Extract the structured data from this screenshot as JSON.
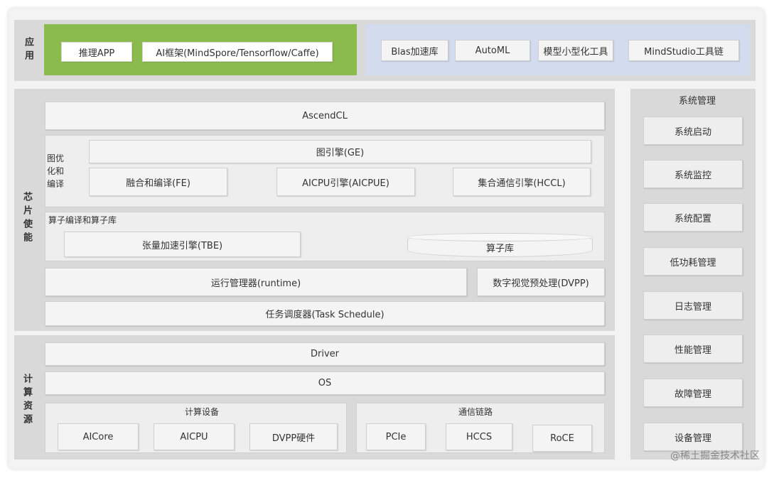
{
  "app_layer": {
    "label": "应用",
    "green": [
      "推理APP",
      "AI框架(MindSpore/Tensorflow/Caffe)"
    ],
    "blue": [
      "Blas加速库",
      "AutoML",
      "模型小型化工具",
      "MindStudio工具链"
    ]
  },
  "chip_layer": {
    "label": "芯片使能",
    "ascendcl": "AscendCL",
    "graph": {
      "label": "图优化和编译",
      "ge": "图引擎(GE)",
      "fe": "融合和编译(FE)",
      "aicpue": "AICPU引擎(AICPUE)",
      "hccl": "集合通信引擎(HCCL)"
    },
    "operator": {
      "label": "算子编译和算子库",
      "tbe": "张量加速引擎(TBE)",
      "lib": "算子库"
    },
    "runtime": "运行管理器(runtime)",
    "dvpp": "数字视觉预处理(DVPP)",
    "task": "任务调度器(Task Schedule)"
  },
  "compute_layer": {
    "label": "计算资源",
    "driver": "Driver",
    "os": "OS",
    "devices": {
      "label": "计算设备",
      "items": [
        "AICore",
        "AICPU",
        "DVPP硬件"
      ]
    },
    "links": {
      "label": "通信链路",
      "items": [
        "PCIe",
        "HCCS",
        "RoCE"
      ]
    }
  },
  "system_mgmt": {
    "label": "系统管理",
    "items": [
      "系统启动",
      "系统监控",
      "系统配置",
      "低功耗管理",
      "日志管理",
      "性能管理",
      "故障管理",
      "设备管理"
    ]
  },
  "watermark": "@稀土掘金技术社区",
  "colors": {
    "green": "#8bbb4c",
    "blue": "#d3dcee",
    "panel": "#d9d9d9"
  }
}
